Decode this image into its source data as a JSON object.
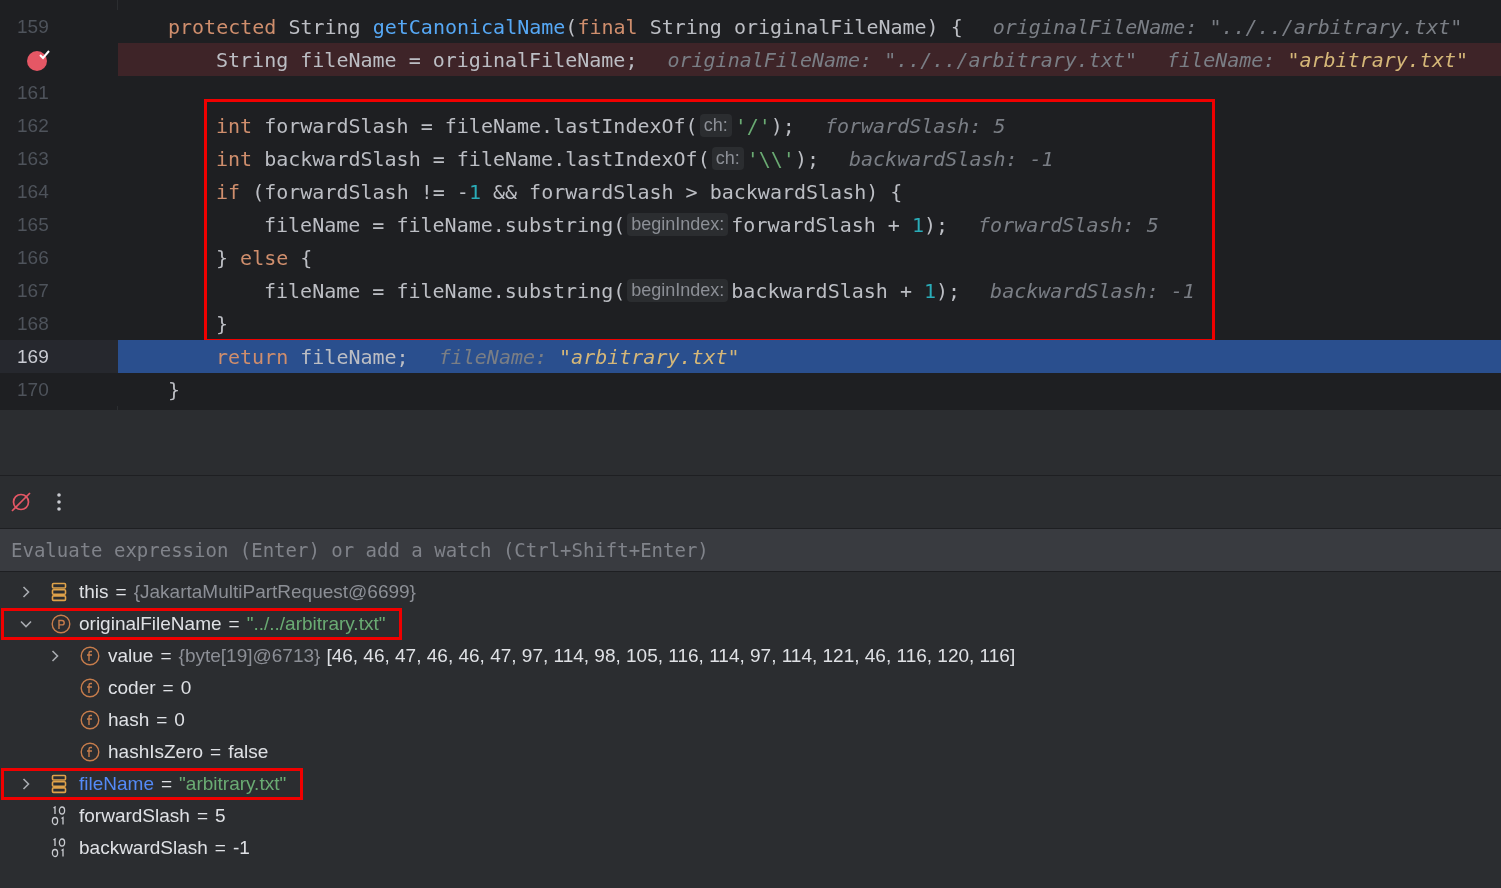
{
  "editor": {
    "lines": [
      {
        "number": "159",
        "kind": "normal",
        "boxed": false,
        "tokens": [
          {
            "kind": "kw",
            "t": "protected"
          },
          {
            "kind": "text",
            "t": " String "
          },
          {
            "kind": "fn",
            "t": "getCanonicalName"
          },
          {
            "kind": "text",
            "t": "("
          },
          {
            "kind": "kw",
            "t": "final"
          },
          {
            "kind": "text",
            "t": " String originalFileName) {"
          }
        ],
        "inline_values": [
          {
            "name": "originalFileName:",
            "value": "\"../../arbitrary.txt\"",
            "changed": false
          }
        ],
        "children": [
          {
            "kind": "breakpoint",
            "boxed": false,
            "tokens": [
              {
                "kind": "text",
                "t": "String fileName = originalFileName;"
              }
            ],
            "inline_values": [
              {
                "name": "originalFileName:",
                "value": "\"../../arbitrary.txt\"",
                "changed": false
              },
              {
                "name": "fileName:",
                "value": "\"arbitrary.txt\"",
                "changed": true
              }
            ]
          },
          {
            "number": "161",
            "kind": "normal",
            "boxed": false
          },
          {
            "number": "162",
            "kind": "normal",
            "boxed": true,
            "tokens": [
              {
                "kind": "kw",
                "t": "int"
              },
              {
                "kind": "text",
                "t": " forwardSlash = fileName.lastIndexOf("
              },
              {
                "kind": "hint",
                "t": "ch:"
              },
              {
                "kind": "str",
                "t": "'/'"
              },
              {
                "kind": "text",
                "t": ");"
              }
            ],
            "inline_values": [
              {
                "name": "forwardSlash:",
                "value": "5",
                "changed": false
              }
            ]
          },
          {
            "number": "163",
            "kind": "normal",
            "boxed": true,
            "tokens": [
              {
                "kind": "kw",
                "t": "int"
              },
              {
                "kind": "text",
                "t": " backwardSlash = fileName.lastIndexOf("
              },
              {
                "kind": "hint",
                "t": "ch:"
              },
              {
                "kind": "str",
                "t": "'\\\\'"
              },
              {
                "kind": "text",
                "t": ");"
              }
            ],
            "inline_values": [
              {
                "name": "backwardSlash:",
                "value": "-1",
                "changed": false
              }
            ]
          },
          {
            "number": "164",
            "kind": "normal",
            "boxed": true,
            "tokens": [
              {
                "kind": "kw",
                "t": "if"
              },
              {
                "kind": "text",
                "t": " (forwardSlash != -"
              },
              {
                "kind": "num",
                "t": "1"
              },
              {
                "kind": "text",
                "t": " && forwardSlash > backwardSlash) {"
              }
            ],
            "children": [
              {
                "number": "165",
                "kind": "normal",
                "boxed": true,
                "tokens": [
                  {
                    "kind": "text",
                    "t": "fileName = fileName.substring("
                  },
                  {
                    "kind": "hint",
                    "t": "beginIndex:"
                  },
                  {
                    "kind": "text",
                    "t": "forwardSlash + "
                  },
                  {
                    "kind": "num",
                    "t": "1"
                  },
                  {
                    "kind": "text",
                    "t": ");"
                  }
                ],
                "inline_values": [
                  {
                    "name": "forwardSlash:",
                    "value": "5",
                    "changed": false
                  }
                ]
              }
            ]
          },
          {
            "number": "166",
            "kind": "normal",
            "boxed": true,
            "tokens": [
              {
                "kind": "text",
                "t": "} "
              },
              {
                "kind": "kw",
                "t": "else"
              },
              {
                "kind": "text",
                "t": " {"
              }
            ],
            "children": [
              {
                "number": "167",
                "kind": "normal",
                "boxed": true,
                "tokens": [
                  {
                    "kind": "text",
                    "t": "fileName = fileName.substring("
                  },
                  {
                    "kind": "hint",
                    "t": "beginIndex:"
                  },
                  {
                    "kind": "text",
                    "t": "backwardSlash + "
                  },
                  {
                    "kind": "num",
                    "t": "1"
                  },
                  {
                    "kind": "text",
                    "t": ");"
                  }
                ],
                "inline_values": [
                  {
                    "name": "backwardSlash:",
                    "value": "-1",
                    "changed": false
                  }
                ]
              }
            ]
          },
          {
            "number": "168",
            "kind": "normal",
            "boxed": true,
            "tokens": [
              {
                "kind": "text",
                "t": "}"
              }
            ]
          },
          {
            "number": "169",
            "kind": "current",
            "boxed": false,
            "tokens": [
              {
                "kind": "kw",
                "t": "return"
              },
              {
                "kind": "text",
                "t": " fileName;"
              }
            ],
            "inline_values": [
              {
                "name": "fileName:",
                "value": "\"arbitrary.txt\"",
                "changed": true
              }
            ]
          }
        ]
      },
      {
        "number": "170",
        "kind": "normal",
        "boxed": false,
        "tokens": [
          {
            "kind": "text",
            "t": "}"
          }
        ]
      }
    ]
  },
  "debugger": {
    "evaluate": {
      "placeholder": "Evaluate expression (Enter) or add a watch (Ctrl+Shift+Enter)"
    },
    "variables": [
      {
        "kind": "object",
        "name": "this",
        "operator": "=",
        "changed": false,
        "boxed": false,
        "expanded": false,
        "value": [
          {
            "kind": "ref",
            "t": "{JakartaMultiPartRequest@6699}"
          }
        ]
      },
      {
        "kind": "param",
        "name": "originalFileName",
        "operator": "=",
        "changed": false,
        "boxed": true,
        "expanded": true,
        "value": [
          {
            "kind": "str",
            "t": "\"../../arbitrary.txt\""
          }
        ],
        "children": [
          {
            "kind": "field",
            "name": "value",
            "operator": "=",
            "changed": false,
            "boxed": false,
            "expanded": false,
            "value": [
              {
                "kind": "ref",
                "t": "{byte[19]@6713}"
              },
              {
                "kind": "plain",
                "t": "[46, 46, 47, 46, 46, 47, 97, 114, 98, 105, 116, 114, 97, 114, 121, 46, 116, 120, 116]"
              }
            ]
          },
          {
            "kind": "field",
            "name": "coder",
            "operator": "=",
            "changed": false,
            "boxed": false,
            "value": [
              {
                "kind": "plain",
                "t": "0"
              }
            ]
          },
          {
            "kind": "field",
            "name": "hash",
            "operator": "=",
            "changed": false,
            "boxed": false,
            "value": [
              {
                "kind": "plain",
                "t": "0"
              }
            ]
          },
          {
            "kind": "field",
            "name": "hashIsZero",
            "operator": "=",
            "changed": false,
            "boxed": false,
            "value": [
              {
                "kind": "plain",
                "t": "false"
              }
            ]
          }
        ]
      },
      {
        "kind": "object",
        "name": "fileName",
        "operator": "=",
        "changed": true,
        "boxed": true,
        "expanded": false,
        "value": [
          {
            "kind": "str",
            "t": "\"arbitrary.txt\""
          }
        ]
      },
      {
        "kind": "primitive",
        "name": "forwardSlash",
        "operator": "=",
        "changed": false,
        "boxed": false,
        "value": [
          {
            "kind": "plain",
            "t": "5"
          }
        ]
      },
      {
        "kind": "primitive",
        "name": "backwardSlash",
        "operator": "=",
        "changed": false,
        "boxed": false,
        "value": [
          {
            "kind": "plain",
            "t": "-1"
          }
        ]
      }
    ]
  }
}
